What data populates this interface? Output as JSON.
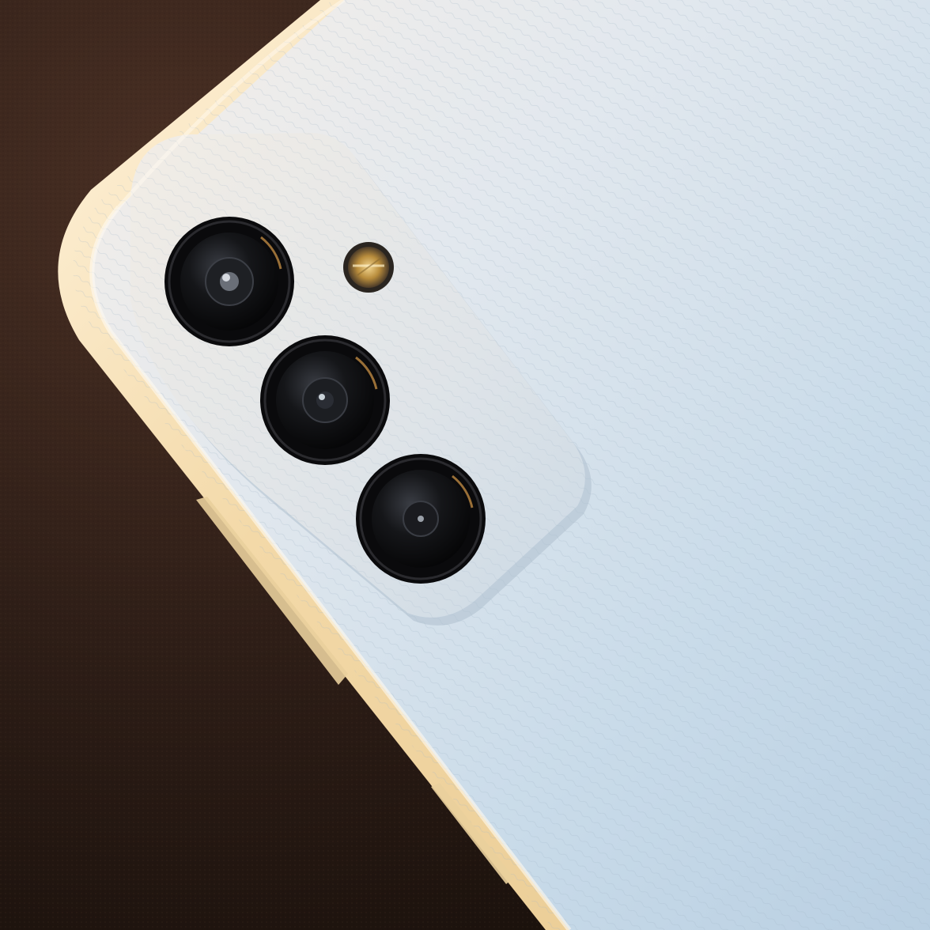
{
  "photo": {
    "subject": "phone-rear-camera-closeup",
    "colors": {
      "surface": "#3a2820",
      "surface_dark": "#1c120d",
      "body_light": "#e8eef2",
      "body_blue": "#c4d8e8",
      "frame_warm": "#f4ddb0",
      "lens_ring": "#0c0c0e",
      "flash_amber": "#d8a84a"
    },
    "lenses": [
      {
        "name": "main-camera-lens"
      },
      {
        "name": "ultrawide-camera-lens"
      },
      {
        "name": "depth-camera-lens"
      }
    ],
    "flash": {
      "name": "led-flash"
    }
  }
}
